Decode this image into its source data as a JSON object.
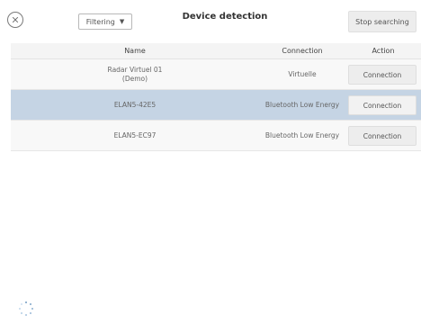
{
  "header": {
    "filter_label": "Filtering",
    "title": "Device detection",
    "stop_label": "Stop searching"
  },
  "table": {
    "columns": {
      "name": "Name",
      "connection": "Connection",
      "action": "Action"
    },
    "rows": [
      {
        "name_line1": "Radar Virtuel 01",
        "name_line2": "(Demo)",
        "connection": "Virtuelle",
        "action": "Connection",
        "selected": false
      },
      {
        "name_line1": "ELAN5-42E5",
        "name_line2": "",
        "connection": "Bluetooth Low Energy",
        "action": "Connection",
        "selected": true
      },
      {
        "name_line1": "ELAN5-EC97",
        "name_line2": "",
        "connection": "Bluetooth Low Energy",
        "action": "Connection",
        "selected": false
      }
    ]
  },
  "colors": {
    "selected_row": "#c5d4e4",
    "button_bg": "#ededed",
    "header_bg": "#f4f4f4"
  },
  "icons": {
    "close": "close-circle-icon",
    "chevron": "chevron-down-icon",
    "spinner": "loading-spinner-icon"
  }
}
